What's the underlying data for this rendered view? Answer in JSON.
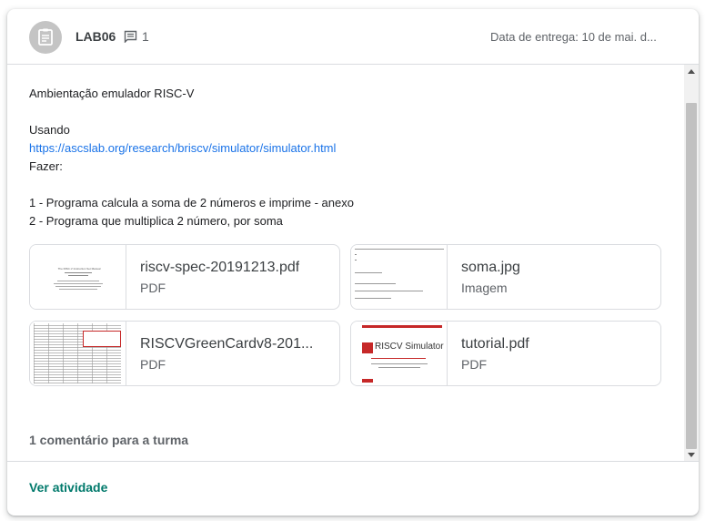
{
  "header": {
    "title": "LAB06",
    "comment_count": "1",
    "due_date": "Data de entrega: 10 de mai. d..."
  },
  "description": {
    "line1": "Ambientação emulador RISC-V",
    "line2": "Usando",
    "link": "https://ascslab.org/research/briscv/simulator/simulator.html",
    "line3": "Fazer:",
    "item1": "1 - Programa calcula a soma de 2 números e imprime - anexo",
    "item2": "2 - Programa que multiplica 2 número, por soma"
  },
  "attachments": [
    {
      "name": "riscv-spec-20191213.pdf",
      "type": "PDF"
    },
    {
      "name": "soma.jpg",
      "type": "Imagem"
    },
    {
      "name": "RISCVGreenCardv8-201...",
      "type": "PDF"
    },
    {
      "name": "tutorial.pdf",
      "type": "PDF"
    }
  ],
  "thumbs": {
    "spec_title": "The RISC-V Instruction Set Manual",
    "simulator_title": "RISCV Simulator"
  },
  "class_comments": "1 comentário para a turma",
  "footer": {
    "activity_label": "Ver atividade"
  },
  "colors": {
    "link": "#1a73e8",
    "accent": "#00796b",
    "red": "#c62828"
  }
}
